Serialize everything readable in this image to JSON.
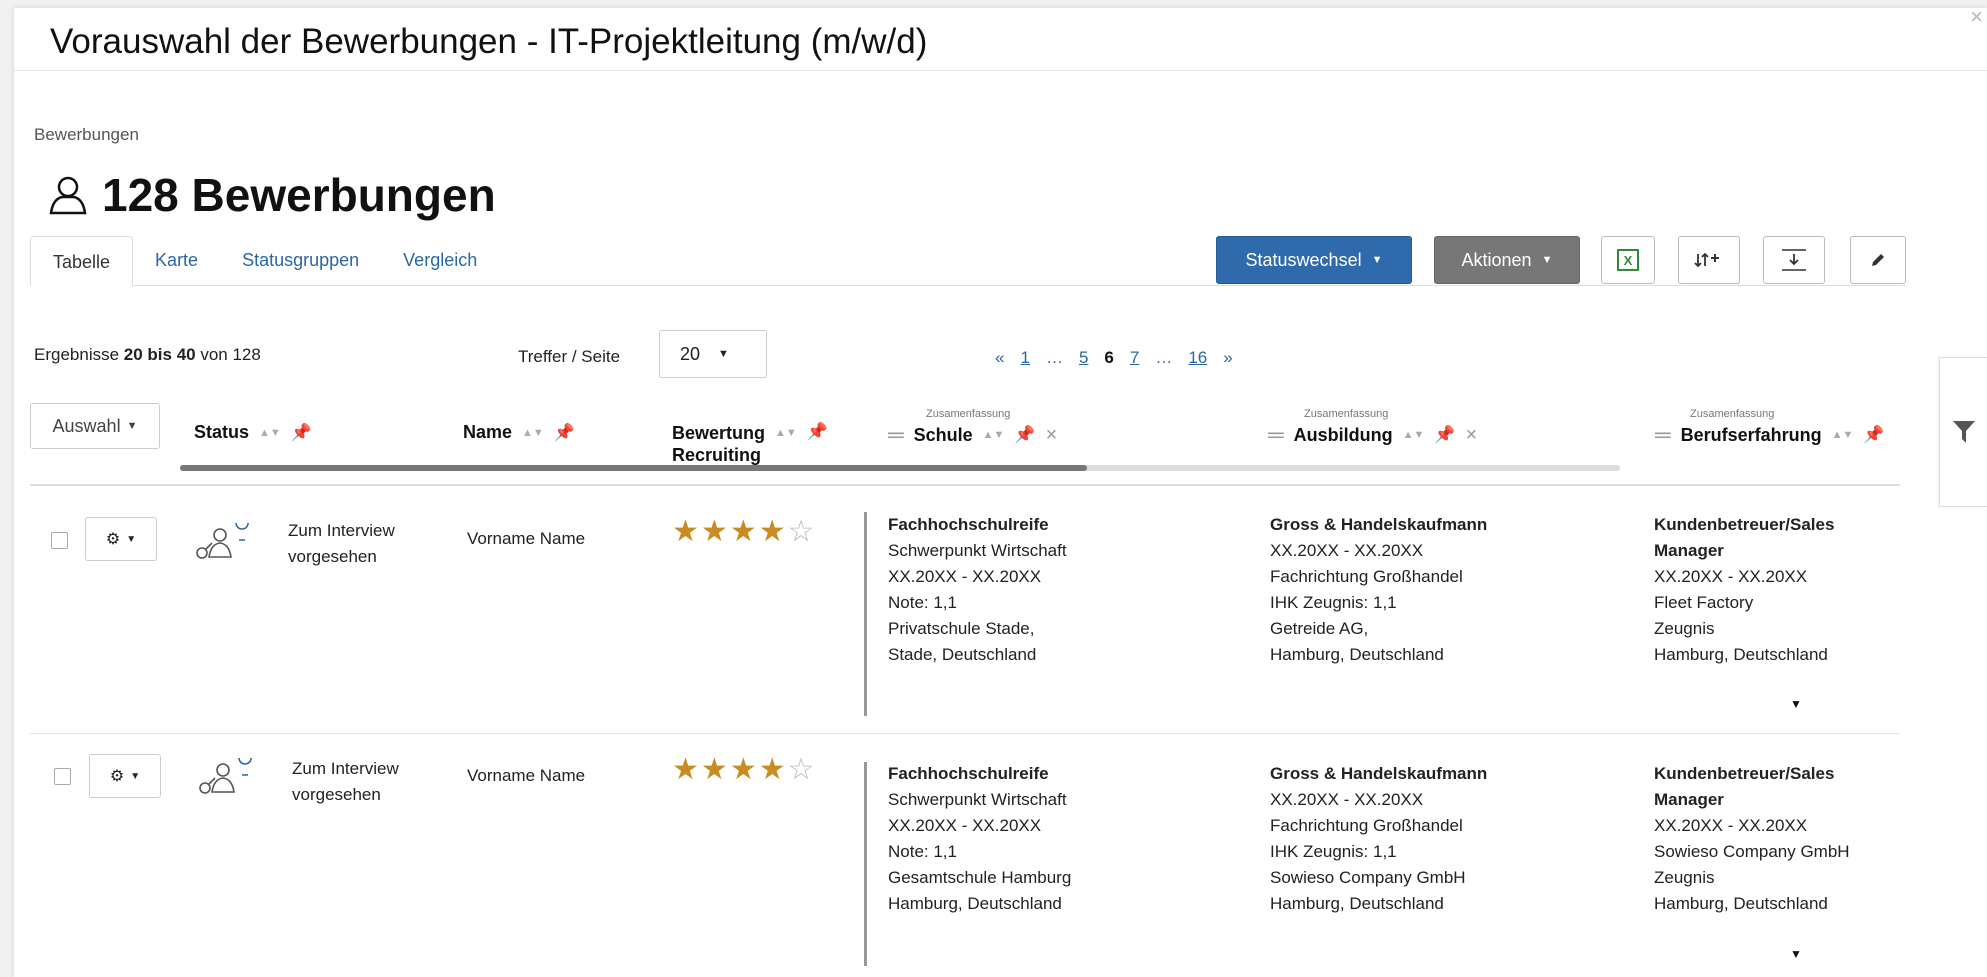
{
  "modal": {
    "title": "Vorauswahl der Bewerbungen  - IT-Projektleitung (m/w/d)",
    "close": "×"
  },
  "breadcrumb": "Bewerbungen",
  "heading": "128 Bewerbungen",
  "tabs": [
    "Tabelle",
    "Karte",
    "Statusgruppen",
    "Vergleich"
  ],
  "toolbar": {
    "statuswechsel": "Statuswechsel",
    "aktionen": "Aktionen",
    "excel_icon": "excel-icon",
    "sort_add_icon": "sort-add-icon",
    "download_icon": "download-icon",
    "edit_icon": "pencil-icon"
  },
  "results": {
    "prefix": "Ergebnisse ",
    "from_to": "20 bis 40",
    "suffix": " von 128"
  },
  "per_page": {
    "label": "Treffer / Seite",
    "value": "20"
  },
  "pagination": {
    "prev": "«",
    "first": "1",
    "ellipsis1": "…",
    "p5": "5",
    "current": "6",
    "p7": "7",
    "ellipsis2": "…",
    "last": "16",
    "next": "»"
  },
  "table": {
    "select_label": "Auswahl",
    "columns": {
      "status": "Status",
      "name": "Name",
      "rating_line1": "Bewertung",
      "rating_line2": "Recruiting",
      "summary_label": "Zusamenfassung",
      "schule": "Schule",
      "ausbildung": "Ausbildung",
      "berufserfahrung": "Berufserfahrung"
    },
    "rows": [
      {
        "status_line1": "Zum Interview",
        "status_line2": "vorgesehen",
        "name": "Vorname Name",
        "rating": 4,
        "schule": [
          "Fachhochschulreife",
          "Schwerpunkt Wirtschaft",
          "XX.20XX - XX.20XX",
          "Note: 1,1",
          "Privatschule Stade,",
          "Stade, Deutschland"
        ],
        "ausbildung": [
          "Gross & Handelskaufmann",
          "XX.20XX - XX.20XX",
          "Fachrichtung Großhandel",
          "IHK Zeugnis: 1,1",
          "Getreide AG,",
          "Hamburg, Deutschland"
        ],
        "beruf": [
          "Kundenbetreuer/Sales",
          "Manager",
          "XX.20XX - XX.20XX",
          "Fleet Factory",
          "Zeugnis",
          "Hamburg, Deutschland"
        ]
      },
      {
        "status_line1": "Zum Interview",
        "status_line2": "vorgesehen",
        "name": "Vorname Name",
        "rating": 4,
        "schule": [
          "Fachhochschulreife",
          "Schwerpunkt Wirtschaft",
          "XX.20XX - XX.20XX",
          "Note: 1,1",
          "Gesamtschule Hamburg",
          "Hamburg, Deutschland"
        ],
        "ausbildung": [
          "Gross & Handelskaufmann",
          "XX.20XX - XX.20XX",
          "Fachrichtung Großhandel",
          "IHK Zeugnis: 1,1",
          "Sowieso Company GmbH",
          "Hamburg, Deutschland"
        ],
        "beruf": [
          "Kundenbetreuer/Sales",
          "Manager",
          "XX.20XX - XX.20XX",
          "Sowieso Company GmbH",
          "Zeugnis",
          "Hamburg, Deutschland"
        ]
      }
    ]
  },
  "colors": {
    "primary": "#2f6aad",
    "link": "#2a67a6",
    "star": "#c98c22",
    "gray_button": "#777777"
  }
}
